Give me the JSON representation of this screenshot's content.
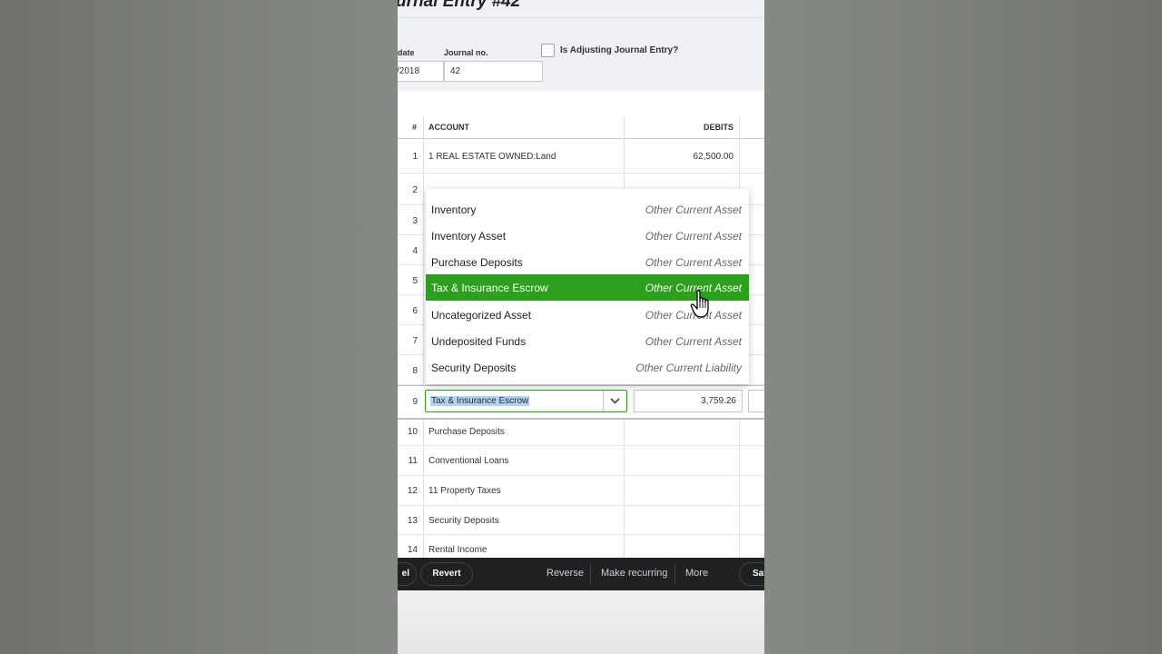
{
  "header": {
    "title": "urnal Entry #42",
    "date_label": "date",
    "date_value": "/2018",
    "journal_no_label": "Journal no.",
    "journal_no_value": "42",
    "adjusting_label": "Is Adjusting Journal Entry?"
  },
  "table": {
    "columns": {
      "num": "#",
      "account": "ACCOUNT",
      "debits": "DEBITS"
    },
    "rows": [
      {
        "num": "1",
        "account": "1 REAL ESTATE OWNED:Land",
        "debit": "62,500.00"
      },
      {
        "num": "2"
      },
      {
        "num": "3"
      },
      {
        "num": "4"
      },
      {
        "num": "5"
      },
      {
        "num": "6"
      },
      {
        "num": "7"
      },
      {
        "num": "8"
      },
      {
        "num": "9",
        "account": "Tax & Insurance Escrow",
        "debit": "3,759.26"
      },
      {
        "num": "10",
        "account": "Purchase Deposits",
        "debit": ""
      },
      {
        "num": "11",
        "account": "Conventional Loans",
        "debit": ""
      },
      {
        "num": "12",
        "account": "11 Property Taxes",
        "debit": ""
      },
      {
        "num": "13",
        "account": "Security Deposits",
        "debit": ""
      },
      {
        "num": "14",
        "account": "Rental Income",
        "debit": ""
      }
    ]
  },
  "dropdown": {
    "items": [
      {
        "name": "Inventory",
        "type": "Other Current Asset"
      },
      {
        "name": "Inventory Asset",
        "type": "Other Current Asset"
      },
      {
        "name": "Purchase Deposits",
        "type": "Other Current Asset"
      },
      {
        "name": "Tax & Insurance Escrow",
        "type": "Other Current Asset",
        "selected": true
      },
      {
        "name": "Uncategorized Asset",
        "type": "Other Current Asset"
      },
      {
        "name": "Undeposited Funds",
        "type": "Other Current Asset"
      },
      {
        "name": "Security Deposits",
        "type": "Other Current Liability"
      }
    ]
  },
  "footer": {
    "cancel": "el",
    "revert": "Revert",
    "reverse": "Reverse",
    "make_recurring": "Make recurring",
    "more": "More",
    "save": "Sav"
  },
  "colors": {
    "accent": "#2ca01c",
    "footer_bg": "#1f2022",
    "selection": "#b3d3f6"
  }
}
